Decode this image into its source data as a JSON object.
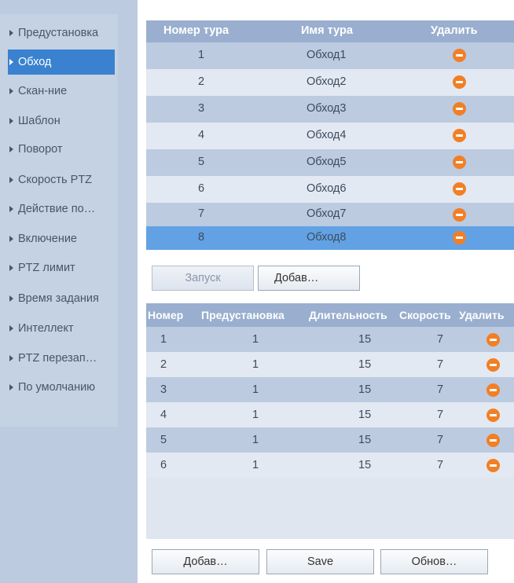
{
  "sidebar": {
    "items": [
      {
        "label": "Предустановка",
        "active": false
      },
      {
        "label": "Обход",
        "active": true
      },
      {
        "label": "Скан-ние",
        "active": false
      },
      {
        "label": "Шаблон",
        "active": false
      },
      {
        "label": "Поворот",
        "active": false
      },
      {
        "label": "Скорость PTZ",
        "active": false
      },
      {
        "label": "Действие по…",
        "active": false
      },
      {
        "label": "Включение",
        "active": false
      },
      {
        "label": "PTZ лимит",
        "active": false
      },
      {
        "label": "Время задания",
        "active": false
      },
      {
        "label": "Интеллект",
        "active": false
      },
      {
        "label": "PTZ перезап…",
        "active": false
      },
      {
        "label": "По умолчанию",
        "active": false
      }
    ]
  },
  "tour_table": {
    "headers": {
      "number": "Номер тура",
      "name": "Имя тура",
      "delete": "Удалить"
    },
    "rows": [
      {
        "number": "1",
        "name": "Обход1"
      },
      {
        "number": "2",
        "name": "Обход2"
      },
      {
        "number": "3",
        "name": "Обход3"
      },
      {
        "number": "4",
        "name": "Обход4"
      },
      {
        "number": "5",
        "name": "Обход5"
      },
      {
        "number": "6",
        "name": "Обход6"
      },
      {
        "number": "7",
        "name": "Обход7"
      },
      {
        "number": "8",
        "name": "Обход8"
      }
    ],
    "selected_number": "8"
  },
  "tour_buttons": {
    "start_label": "Запуск",
    "add_label": "Добав…"
  },
  "preset_table": {
    "headers": {
      "number": "Номер",
      "preset": "Предустановка",
      "duration": "Длительность",
      "speed": "Скорость",
      "delete": "Удалить"
    },
    "rows": [
      {
        "number": "1",
        "preset": "1",
        "duration": "15",
        "speed": "7"
      },
      {
        "number": "2",
        "preset": "1",
        "duration": "15",
        "speed": "7"
      },
      {
        "number": "3",
        "preset": "1",
        "duration": "15",
        "speed": "7"
      },
      {
        "number": "4",
        "preset": "1",
        "duration": "15",
        "speed": "7"
      },
      {
        "number": "5",
        "preset": "1",
        "duration": "15",
        "speed": "7"
      },
      {
        "number": "6",
        "preset": "1",
        "duration": "15",
        "speed": "7"
      }
    ]
  },
  "bottom_buttons": {
    "add_label": "Добав…",
    "save_label": "Save",
    "refresh_label": "Обнов…"
  },
  "colors": {
    "accent": "#3a82cf",
    "selected_row": "#62a2e4",
    "header": "#9aafcf",
    "delete_icon": "#f27f24"
  }
}
